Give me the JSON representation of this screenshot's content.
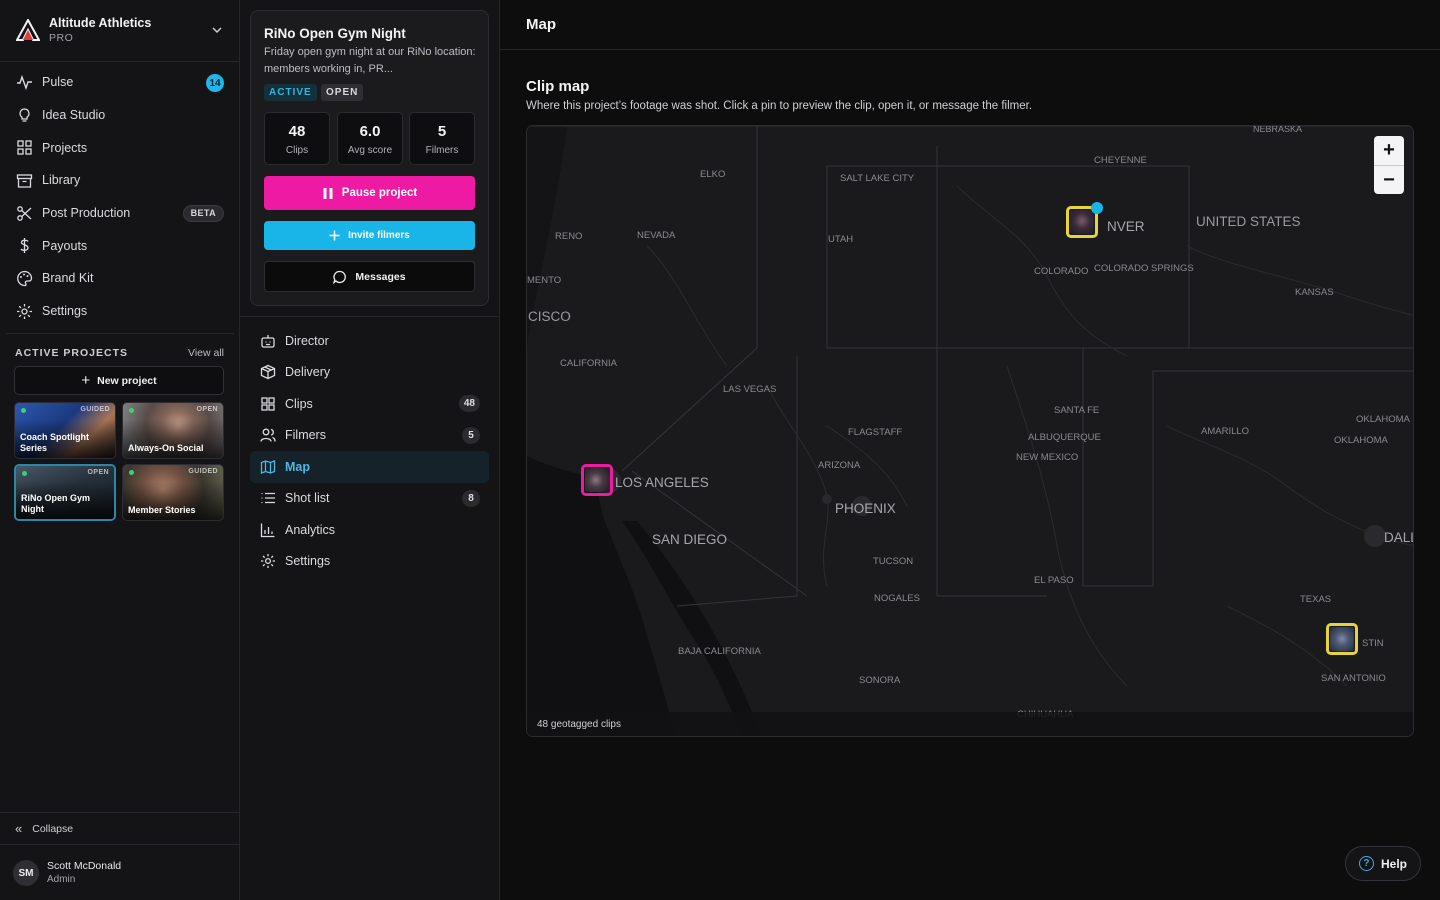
{
  "org": {
    "name": "Altitude Athletics",
    "plan": "PRO"
  },
  "nav": [
    {
      "label": "Pulse",
      "icon": "pulse-icon",
      "badge": "14"
    },
    {
      "label": "Idea Studio",
      "icon": "lightbulb-icon"
    },
    {
      "label": "Projects",
      "icon": "grid-icon"
    },
    {
      "label": "Library",
      "icon": "archive-icon"
    },
    {
      "label": "Post Production",
      "icon": "scissors-icon",
      "pill": "BETA"
    },
    {
      "label": "Payouts",
      "icon": "dollar-icon"
    },
    {
      "label": "Brand Kit",
      "icon": "palette-icon"
    },
    {
      "label": "Settings",
      "icon": "gear-icon"
    }
  ],
  "active_projects": {
    "heading": "ACTIVE PROJECTS",
    "view_all": "View all",
    "new_project": "New project",
    "items": [
      {
        "label": "Coach Spotlight Series",
        "status": "GUIDED"
      },
      {
        "label": "Always-On Social",
        "status": "OPEN"
      },
      {
        "label": "RiNo Open Gym Night",
        "status": "OPEN"
      },
      {
        "label": "Member Stories",
        "status": "GUIDED"
      }
    ]
  },
  "collapse_label": "Collapse",
  "user": {
    "initials": "SM",
    "name": "Scott McDonald",
    "role": "Admin"
  },
  "project": {
    "title": "RiNo Open Gym Night",
    "description": "Friday open gym night at our RiNo location: members working in, PR...",
    "tags": [
      "ACTIVE",
      "OPEN"
    ],
    "stats": [
      {
        "value": "48",
        "label": "Clips"
      },
      {
        "value": "6.0",
        "label": "Avg score"
      },
      {
        "value": "5",
        "label": "Filmers"
      }
    ],
    "pause_label": "Pause project",
    "invite_label": "Invite filmers",
    "messages_label": "Messages"
  },
  "project_nav": [
    {
      "label": "Director",
      "icon": "robot-icon"
    },
    {
      "label": "Delivery",
      "icon": "package-icon"
    },
    {
      "label": "Clips",
      "icon": "grid-icon",
      "badge": "48"
    },
    {
      "label": "Filmers",
      "icon": "users-icon",
      "badge": "5"
    },
    {
      "label": "Map",
      "icon": "map-icon",
      "active": true
    },
    {
      "label": "Shot list",
      "icon": "list-icon",
      "badge": "8"
    },
    {
      "label": "Analytics",
      "icon": "chart-icon"
    },
    {
      "label": "Settings",
      "icon": "gear-icon"
    }
  ],
  "main": {
    "title": "Map",
    "section_title": "Clip map",
    "section_subtitle": "Where this project’s footage was shot. Click a pin to preview the clip, open it, or message the filmer.",
    "footer": "48 geotagged clips",
    "help_label": "Help",
    "zoom_in": "+",
    "zoom_out": "−"
  },
  "map_labels": {
    "nebraska": "NEBRASKA",
    "cheyenne": "CHEYENNE",
    "elko": "ELKO",
    "salt_lake_city": "SALT LAKE CITY",
    "denver": "NVER",
    "united_states": "UNITED STATES",
    "reno": "RENO",
    "nevada": "NEVADA",
    "utah": "UTAH",
    "sacramento": "MENTO",
    "colorado": "COLORADO",
    "colorado_springs": "COLORADO SPRINGS",
    "kansas": "KANSAS",
    "san_francisco": "CISCO",
    "california": "CALIFORNIA",
    "las_vegas": "LAS VEGAS",
    "santa_fe": "SANTA FE",
    "oklahoma_city": "OKLAHOMA",
    "oklahoma": "OKLAHOMA",
    "flagstaff": "FLAGSTAFF",
    "albuquerque": "ALBUQUERQUE",
    "amarillo": "AMARILLO",
    "new_mexico": "NEW MEXICO",
    "arizona": "ARIZONA",
    "los_angeles": "LOS ANGELES",
    "phoenix": "PHOENIX",
    "san_diego": "SAN DIEGO",
    "dallas": "DALL",
    "tucson": "TUCSON",
    "el_paso": "EL PASO",
    "nogales": "NOGALES",
    "texas": "TEXAS",
    "austin": "STIN",
    "baja_california": "BAJA CALIFORNIA",
    "sonora": "SONORA",
    "san_antonio": "SAN ANTONIO",
    "chihuahua": "CHIHUAHUA"
  },
  "colors": {
    "accent_pink": "#ee1aa3",
    "accent_blue": "#19b5e9",
    "pin_yellow": "#e6d43a"
  }
}
